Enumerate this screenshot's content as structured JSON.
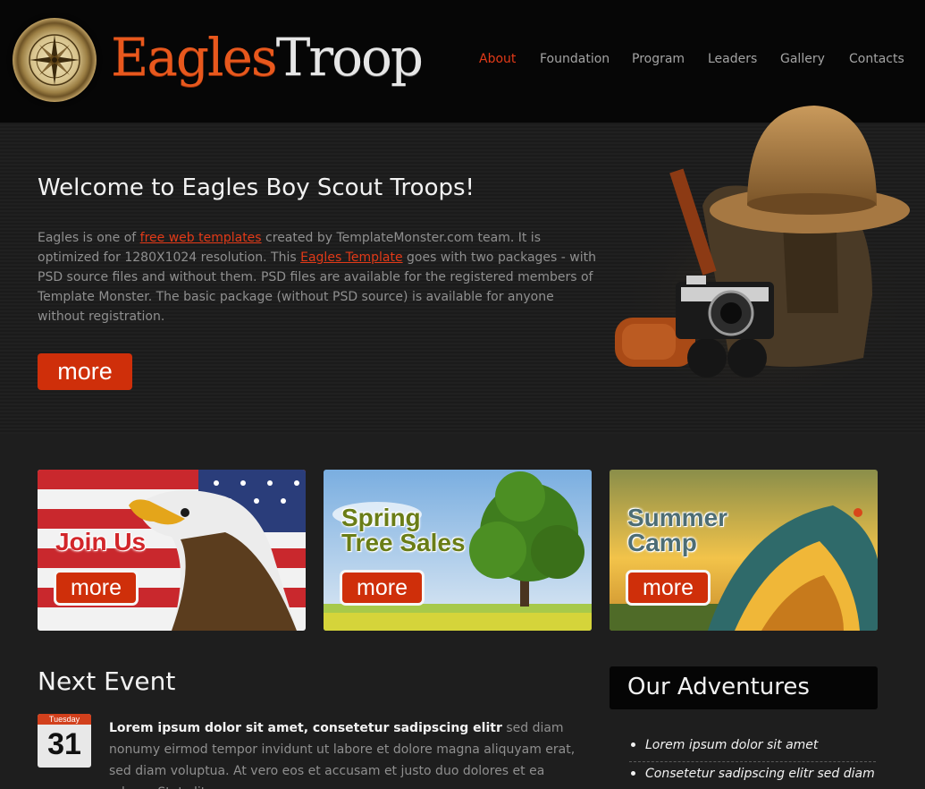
{
  "header": {
    "logo_part1": "Eagles",
    "logo_part2": "Troop",
    "logo_icon": "compass-icon",
    "nav": [
      {
        "label": "About",
        "active": true
      },
      {
        "label": "Foundation",
        "active": false
      },
      {
        "label": "Program",
        "active": false
      },
      {
        "label": "Leaders",
        "active": false
      },
      {
        "label": "Gallery",
        "active": false
      },
      {
        "label": "Contacts",
        "active": false
      }
    ]
  },
  "hero": {
    "title": "Welcome to Eagles Boy Scout Troops!",
    "text_1": "Eagles is one of ",
    "link_1": "free web templates",
    "text_2": " created by TemplateMonster.com team. It is optimized for 1280X1024 resolution. This ",
    "link_2": "Eagles Template",
    "text_3": " goes with two packages - with PSD source files and without them. PSD files are available for the registered members of Template Monster. The basic package (without PSD source) is available for anyone without registration.",
    "button": "more",
    "image": "scout-gear-image"
  },
  "tiles": [
    {
      "line1": "Join Us",
      "line2": "",
      "button": "more",
      "image": "eagle-flag-image"
    },
    {
      "line1": "Spring",
      "line2": "Tree Sales",
      "button": "more",
      "image": "tree-field-image"
    },
    {
      "line1": "Summer",
      "line2": "Camp",
      "button": "more",
      "image": "tent-sunset-image"
    }
  ],
  "event": {
    "title": "Next Event",
    "calendar_day": "Tuesday",
    "calendar_date": "31",
    "lead": "Lorem ipsum dolor sit amet, consetetur sadipscing elitr",
    "body": " sed diam nonumy eirmod tempor invidunt ut labore et dolore magna aliquyam erat, sed diam voluptua. At vero eos et accusam et justo duo dolores et ea rebum. Stet clita"
  },
  "adventures": {
    "title": "Our Adventures",
    "items": [
      "Lorem ipsum dolor sit amet",
      "Consetetur sadipscing elitr sed diam"
    ]
  },
  "colors": {
    "accent": "#cf2f0a",
    "nav_active": "#e23a18",
    "logo_orange": "#e8581d",
    "background": "#1e1e1e"
  }
}
